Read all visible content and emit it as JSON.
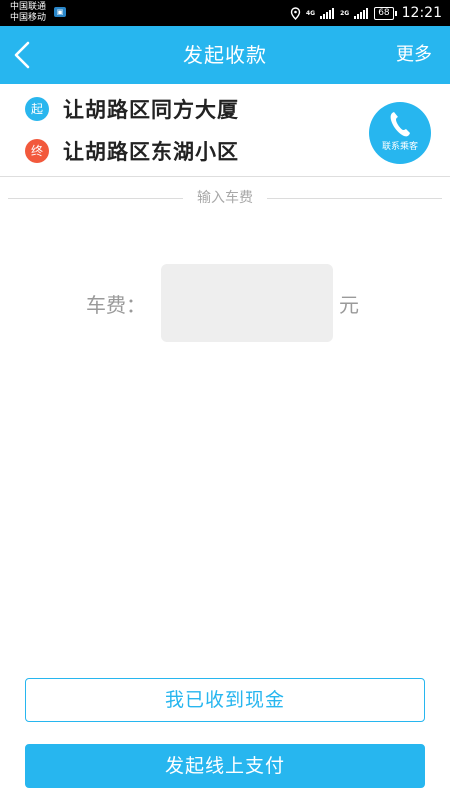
{
  "status_bar": {
    "carrier_1": "中国联通",
    "carrier_2": "中国移动",
    "network_1": "4G",
    "network_2": "2G",
    "battery": "68",
    "time": "12:21"
  },
  "title_bar": {
    "back_icon": "chevron-left-icon",
    "title": "发起收款",
    "more_label": "更多"
  },
  "route": {
    "start_tag": "起",
    "start_location": "让胡路区同方大厦",
    "start_color": "#29b6ee",
    "end_tag": "终",
    "end_location": "让胡路区东湖小区",
    "end_color": "#f2593c",
    "contact_label": "联系乘客",
    "contact_icon": "phone-icon"
  },
  "fare": {
    "section_label": "输入车费",
    "label": "车费：",
    "value": "",
    "unit": "元"
  },
  "actions": {
    "cash_label": "我已收到现金",
    "online_label": "发起线上支付"
  },
  "colors": {
    "accent": "#27b6ef",
    "text_dark": "#222222",
    "text_muted": "#9a9a9a"
  }
}
